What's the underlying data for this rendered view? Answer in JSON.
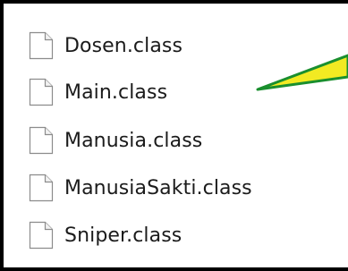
{
  "files": [
    {
      "name": "Dosen.class",
      "icon": "file-icon"
    },
    {
      "name": "Main.class",
      "icon": "file-icon"
    },
    {
      "name": "Manusia.class",
      "icon": "file-icon"
    },
    {
      "name": "ManusiaSakti.class",
      "icon": "file-icon"
    },
    {
      "name": "Sniper.class",
      "icon": "file-icon"
    }
  ],
  "annotation": {
    "icon": "arrow-icon",
    "stroke_color": "#1a8f2e",
    "fill_color": "#f2ea22"
  },
  "colors": {
    "border": "#000000",
    "text": "#1b1b1b",
    "background": "#ffffff"
  }
}
